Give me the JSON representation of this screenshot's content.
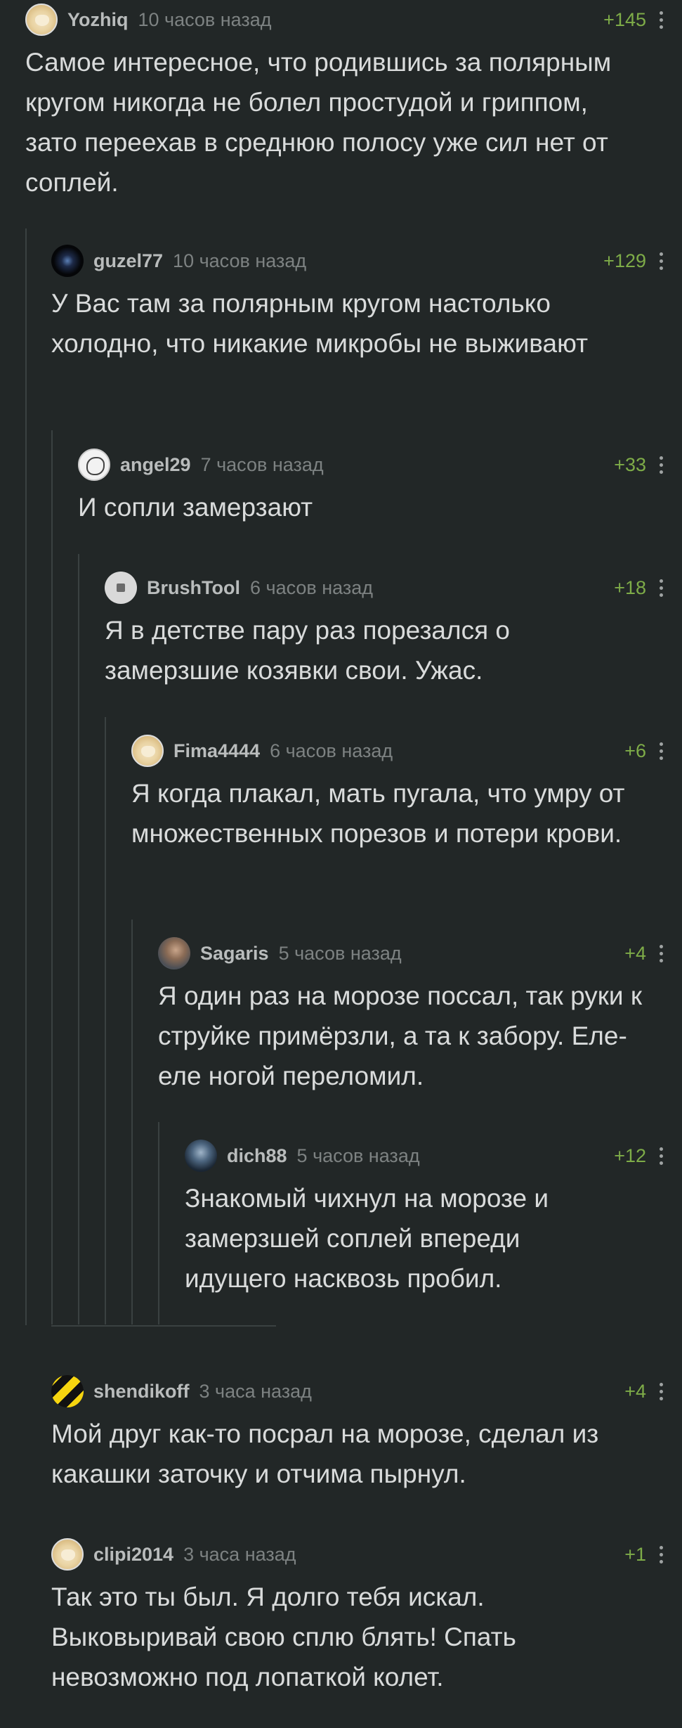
{
  "comments": [
    {
      "username": "Yozhiq",
      "time": "10 часов назад",
      "rating": "+145",
      "avatar": "doge-avatar-icon",
      "text": "Самое интересное, что родившись за полярным кругом никогда не болел простудой и гриппом, зато переехав в среднюю полосу уже сил нет от соплей."
    },
    {
      "username": "guzel77",
      "time": "10 часов назад",
      "rating": "+129",
      "avatar": "space-avatar-icon",
      "text": "У Вас там за полярным кругом настолько холодно, что никакие микробы не выживают"
    },
    {
      "username": "angel29",
      "time": "7 часов назад",
      "rating": "+33",
      "avatar": "sketch-avatar-icon",
      "text": "И сопли замерзают"
    },
    {
      "username": "BrushTool",
      "time": "6 часов назад",
      "rating": "+18",
      "avatar": "default-avatar-icon",
      "text": "Я в детстве пару раз порезался о замерзшие козявки свои. Ужас."
    },
    {
      "username": "Fima4444",
      "time": "6 часов назад",
      "rating": "+6",
      "avatar": "doge-avatar-icon",
      "text": "Я когда плакал, мать пугала, что умру от множественных порезов и потери крови."
    },
    {
      "username": "Sagaris",
      "time": "5 часов назад",
      "rating": "+4",
      "avatar": "photo-avatar-icon",
      "text": "Я один раз на морозе поссал, так руки к струйке примёрзли, а та к забору. Еле-еле ногой переломил."
    },
    {
      "username": "dich88",
      "time": "5 часов назад",
      "rating": "+12",
      "avatar": "hero-avatar-icon",
      "text": "Знакомый чихнул на морозе и замерзшей соплей впереди идущего насквозь пробил."
    },
    {
      "username": "shendikoff",
      "time": "3 часа назад",
      "rating": "+4",
      "avatar": "striped-avatar-icon",
      "text": "Мой друг как-то посрал на морозе, сделал из какашки заточку и отчима пырнул."
    },
    {
      "username": "clipi2014",
      "time": "3 часа назад",
      "rating": "+1",
      "avatar": "doge-avatar-icon",
      "text": "Так это ты был. Я долго тебя искал. Выковыривай свою сплю блять! Спать невозможно под лопаткой колет."
    }
  ],
  "colors": {
    "background": "#222727",
    "rating": "#7eac48",
    "username": "#b9bcbc",
    "time": "#7d8282",
    "thread_line": "#3a4141"
  }
}
